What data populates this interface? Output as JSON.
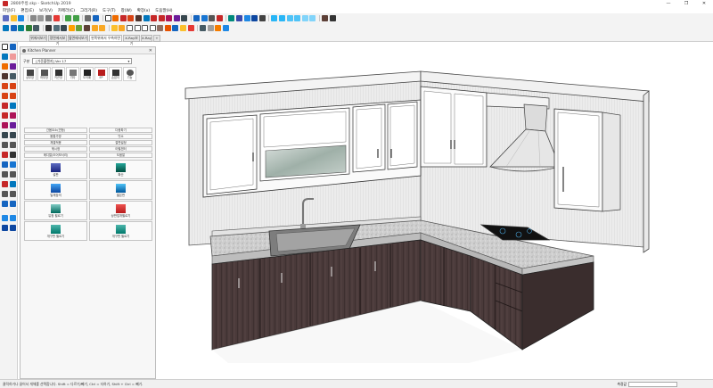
{
  "window": {
    "title": "2800주방.skp - SketchUp 2019",
    "controls": [
      "—",
      "❐",
      "✕"
    ]
  },
  "menu": [
    "파일(F)",
    "편집(E)",
    "보기(V)",
    "카메라(C)",
    "그리기(R)",
    "도구(T)",
    "창(W)",
    "확장(x)",
    "도움말(H)"
  ],
  "tabs": [
    "위에서보기",
    "정면에서보기",
    "옆면에서보기",
    "왼쪽위에서 우측하면",
    "X-Ray보기",
    "X-Ray",
    "+"
  ],
  "panel": {
    "title": "Kitchen Planner",
    "close": "✕",
    "category_label": "구분",
    "category_value": "[가준풀렌지] Ver 17",
    "icons": [
      {
        "label": "상부장",
        "color": "#444444",
        "icon": "upper-cabinet-icon"
      },
      {
        "label": "하부장",
        "color": "#555555",
        "icon": "lower-cabinet-icon"
      },
      {
        "label": "키큰장",
        "color": "#333333",
        "icon": "tall-cabinet-icon"
      },
      {
        "label": "기타",
        "color": "#777777",
        "icon": "misc-icon"
      },
      {
        "label": "도어패",
        "color": "#222222",
        "icon": "door-icon"
      },
      {
        "label": "EP",
        "color": "#b71c1c",
        "icon": "ep-icon"
      },
      {
        "label": "손잡이",
        "color": "#333333",
        "icon": "handle-icon"
      },
      {
        "label": "기능",
        "color": "#555555",
        "icon": "settings-icon"
      }
    ],
    "buttons": [
      "간몸요소(연등)",
      "다중파기",
      "몸통가방",
      "잇소",
      "체결적용",
      "절편설정",
      "묶시정",
      "아필겐터",
      "메디얼(도어모서리)",
      "도움말"
    ],
    "big_buttons": [
      "설판",
      "확산",
      "일체장의",
      "짧은판",
      "유정 필르기",
      "상판덮개필르기",
      "개구판 필르기",
      "개구판 필르기"
    ]
  },
  "statusbar": {
    "text": "클릭하거나 끌어서 개체를 선택합니다. Shift = 다르기/빼기, Ctrl = 더하기, Shift + Ctrl = 빼기.",
    "measure_label": "측정값"
  }
}
